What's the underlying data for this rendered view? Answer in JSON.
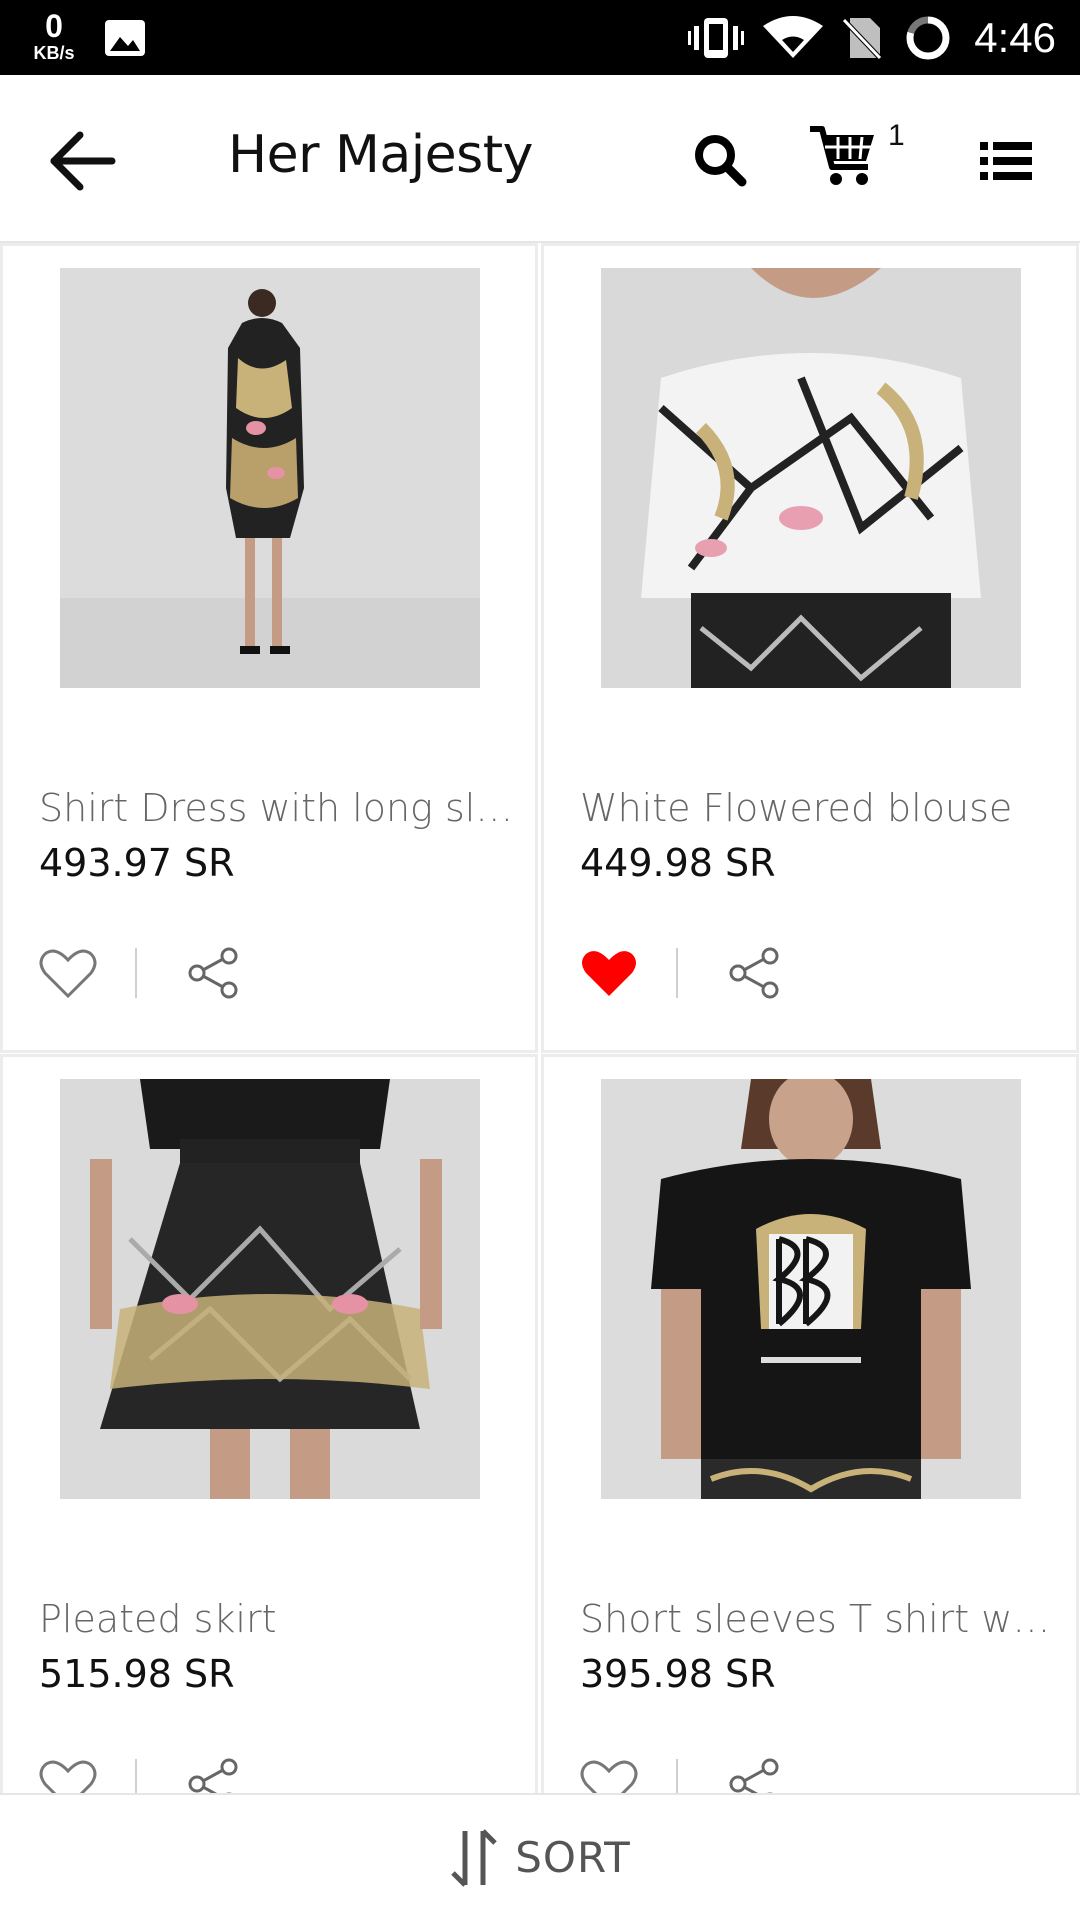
{
  "status_bar": {
    "speed_value": "0",
    "speed_unit": "KB/s",
    "time": "4:46"
  },
  "toolbar": {
    "title": "Her Majesty",
    "cart_count": "1"
  },
  "products": [
    {
      "name": "Shirt Dress with long slee...",
      "price": "493.97 SR",
      "favorited": false,
      "image": "model-in-patterned-shirt-dress"
    },
    {
      "name": "White Flowered blouse",
      "price": "449.98 SR",
      "favorited": true,
      "image": "model-in-white-patterned-blouse"
    },
    {
      "name": "Pleated skirt",
      "price": "515.98 SR",
      "favorited": false,
      "image": "model-in-black-pleated-skirt"
    },
    {
      "name": "Short sleeves T shirt with...",
      "price": "395.98 SR",
      "favorited": false,
      "image": "model-in-black-logo-tshirt"
    }
  ],
  "sort": {
    "label": "SORT"
  },
  "colors": {
    "favorite": "#ff0000",
    "status_bar": "#000000"
  }
}
